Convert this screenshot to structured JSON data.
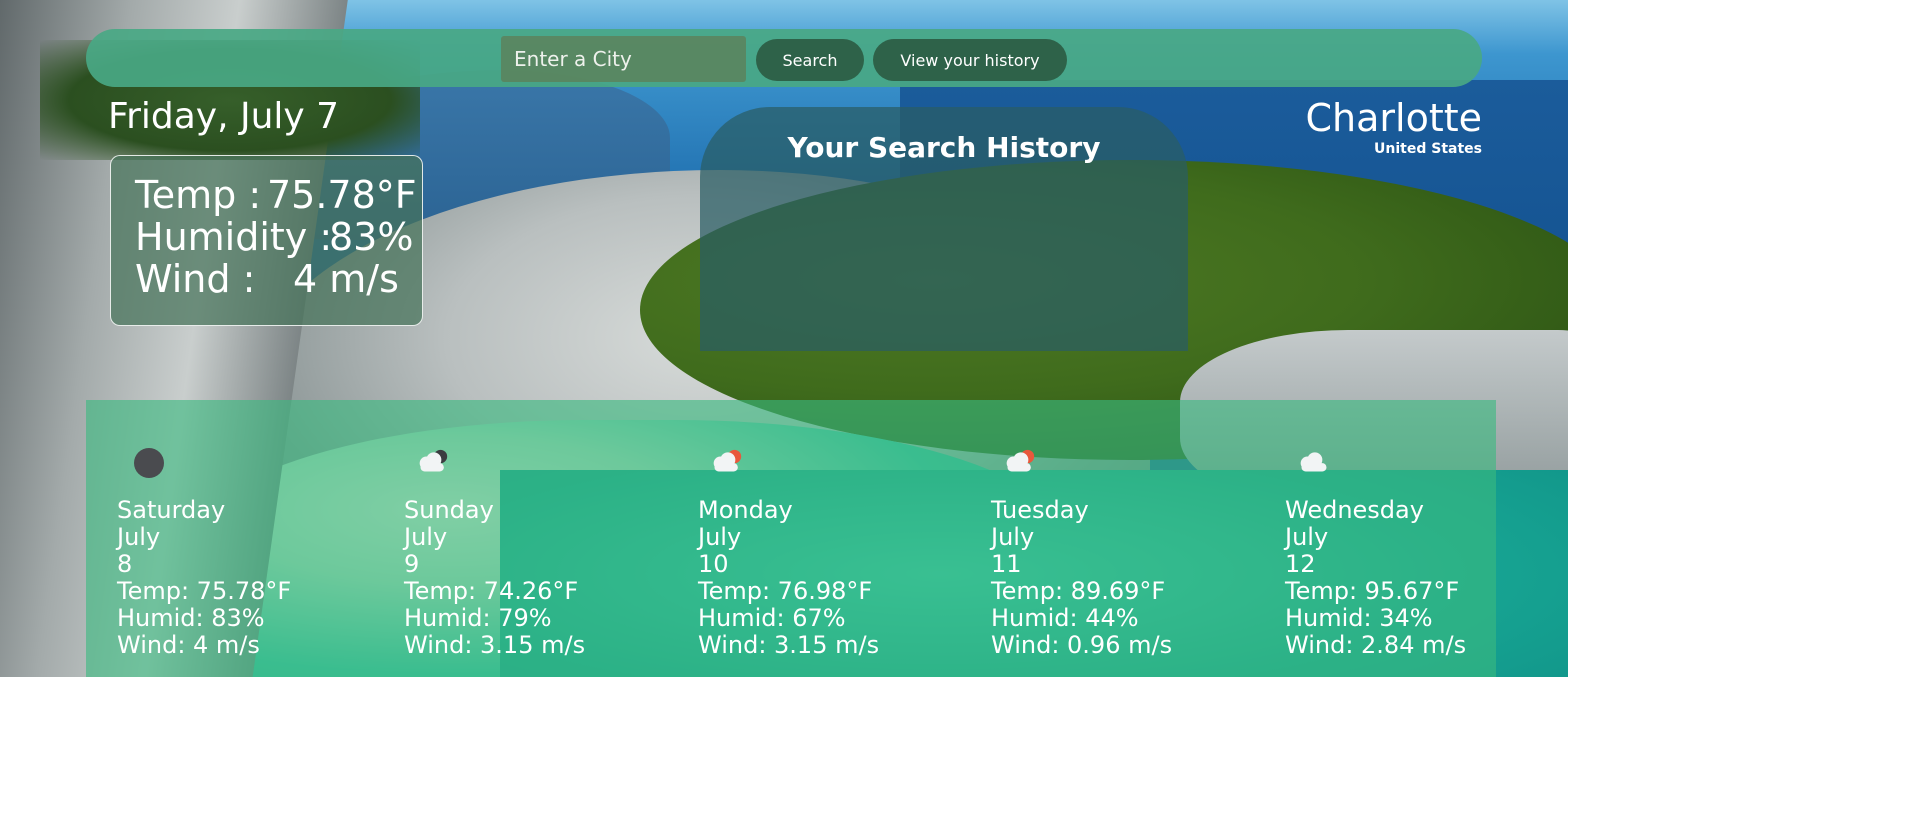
{
  "navbar": {
    "search_placeholder": "Enter a City",
    "search_button": "Search",
    "history_button": "View your history"
  },
  "current": {
    "date": "Friday, July 7",
    "temp_label": "Temp :",
    "temp_value": "75.78°F",
    "humidity_label": "Humidity :",
    "humidity_value": "83%",
    "wind_label": "Wind :",
    "wind_value": "4 m/s"
  },
  "location": {
    "city": "Charlotte",
    "country": "United States"
  },
  "history": {
    "title": "Your Search History"
  },
  "forecast": [
    {
      "icon": "moon-icon",
      "day": "Saturday",
      "month": "July",
      "date": "8",
      "temp": "Temp: 75.78°F",
      "humid": "Humid: 83%",
      "wind": "Wind: 4 m/s"
    },
    {
      "icon": "cloud-night-icon",
      "day": "Sunday",
      "month": "July",
      "date": "9",
      "temp": "Temp: 74.26°F",
      "humid": "Humid: 79%",
      "wind": "Wind: 3.15 m/s"
    },
    {
      "icon": "cloud-sun-icon",
      "day": "Monday",
      "month": "July",
      "date": "10",
      "temp": "Temp: 76.98°F",
      "humid": "Humid: 67%",
      "wind": "Wind: 3.15 m/s"
    },
    {
      "icon": "cloud-sun-icon",
      "day": "Tuesday",
      "month": "July",
      "date": "11",
      "temp": "Temp: 89.69°F",
      "humid": "Humid: 44%",
      "wind": "Wind: 0.96 m/s"
    },
    {
      "icon": "cloud-icon",
      "day": "Wednesday",
      "month": "July",
      "date": "12",
      "temp": "Temp: 95.67°F",
      "humid": "Humid: 34%",
      "wind": "Wind: 2.84 m/s"
    }
  ],
  "colors": {
    "navbar": "#49a884",
    "button": "#2e6249",
    "forecast_panel": "#3aba80",
    "history_panel": "#2a5d64"
  }
}
